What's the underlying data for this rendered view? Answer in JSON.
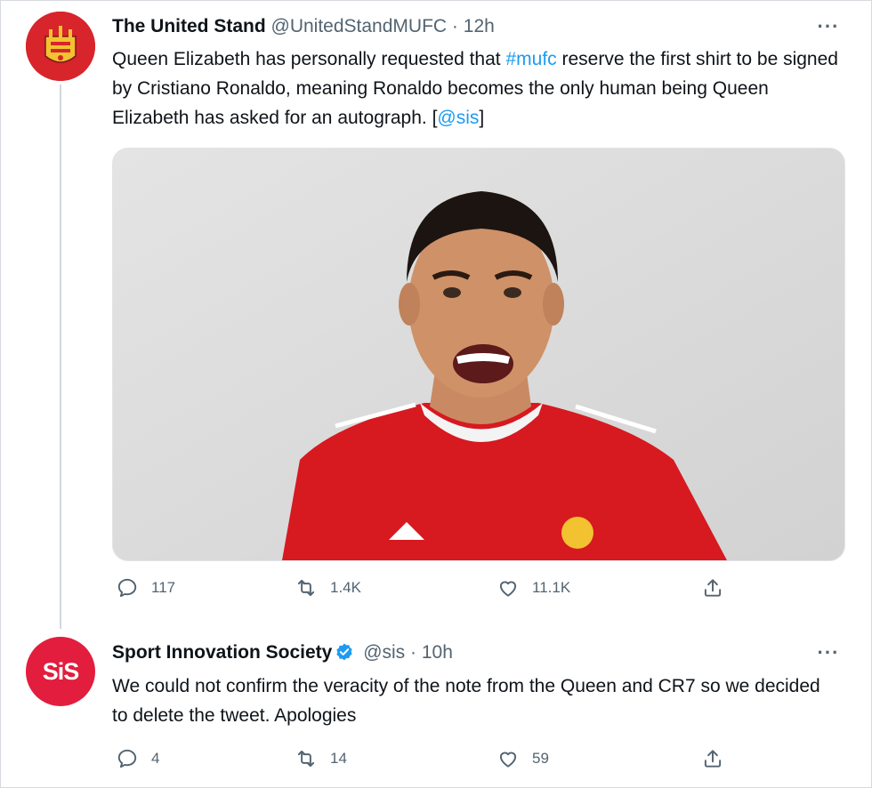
{
  "tweets": [
    {
      "name": "The United Stand",
      "handle": "@UnitedStandMUFC",
      "separator": "·",
      "time": "12h",
      "text_parts": [
        "Queen Elizabeth has personally requested that ",
        "#mufc",
        " reserve the first shirt to be signed by Cristiano Ronaldo, meaning Ronaldo becomes the only human being Queen Elizabeth has asked for an autograph. [",
        "@sis",
        "]"
      ],
      "more_label": "···",
      "actions": {
        "replies": "117",
        "retweets": "1.4K",
        "likes": "11.1K"
      }
    },
    {
      "name": "Sport Innovation Society",
      "handle": "@sis",
      "separator": "·",
      "time": "10h",
      "avatar_text": "SiS",
      "text": "We could not confirm the veracity of the note from the Queen and CR7 so we decided to delete the tweet. Apologies",
      "more_label": "···",
      "actions": {
        "replies": "4",
        "retweets": "14",
        "likes": "59"
      }
    }
  ],
  "colors": {
    "link": "#1d9bf0",
    "meta": "#536471",
    "verified": "#1d9bf0",
    "shirt": "#d71920",
    "avatar_uts": "#d8242b",
    "avatar_sis": "#e21d3d"
  },
  "icons": [
    "reply-icon",
    "retweet-icon",
    "like-icon",
    "share-icon",
    "verified-badge-icon",
    "more-icon"
  ]
}
